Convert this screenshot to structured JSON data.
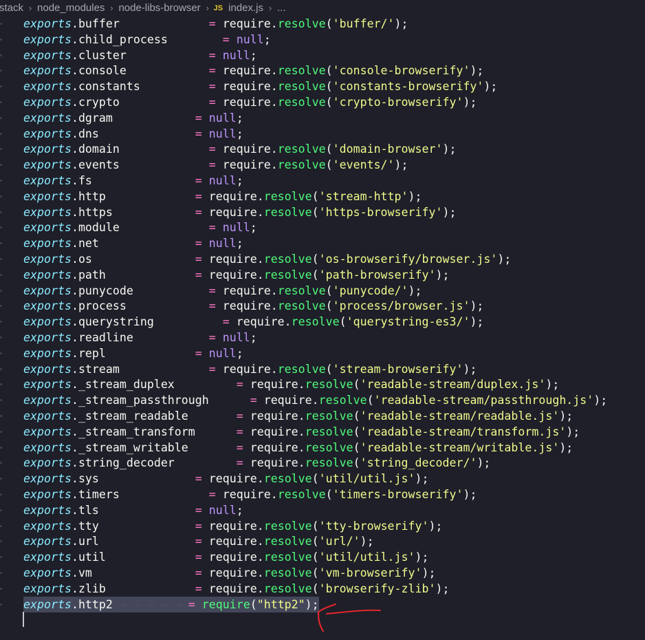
{
  "breadcrumb": {
    "items": [
      "stack",
      "node_modules",
      "node-libs-browser"
    ],
    "file_icon": "JS",
    "file_name": "index.js",
    "ellipsis": "..."
  },
  "editor": {
    "lines": [
      {
        "prop": "buffer",
        "pad": "             ",
        "value_type": "require",
        "arg": "'buffer/'",
        "end": ");"
      },
      {
        "prop": "child_process",
        "pad": "        ",
        "value_type": "null",
        "end": ";"
      },
      {
        "prop": "cluster",
        "pad": "            ",
        "value_type": "null",
        "end": ";"
      },
      {
        "prop": "console",
        "pad": "            ",
        "value_type": "require",
        "arg": "'console-browserify'",
        "end": ");"
      },
      {
        "prop": "constants",
        "pad": "          ",
        "value_type": "require",
        "arg": "'constants-browserify'",
        "end": ");"
      },
      {
        "prop": "crypto",
        "pad": "             ",
        "value_type": "require",
        "arg": "'crypto-browserify'",
        "end": ");"
      },
      {
        "prop": "dgram",
        "pad": "            ",
        "value_type": "null",
        "end": ";"
      },
      {
        "prop": "dns",
        "pad": "              ",
        "value_type": "null",
        "end": ";"
      },
      {
        "prop": "domain",
        "pad": "             ",
        "value_type": "require",
        "arg": "'domain-browser'",
        "end": ");"
      },
      {
        "prop": "events",
        "pad": "             ",
        "value_type": "require",
        "arg": "'events/'",
        "end": ");"
      },
      {
        "prop": "fs",
        "pad": "               ",
        "value_type": "null",
        "end": ";"
      },
      {
        "prop": "http",
        "pad": "             ",
        "value_type": "require",
        "arg": "'stream-http'",
        "end": ");"
      },
      {
        "prop": "https",
        "pad": "            ",
        "value_type": "require",
        "arg": "'https-browserify'",
        "end": ");"
      },
      {
        "prop": "module",
        "pad": "             ",
        "value_type": "null",
        "end": ";"
      },
      {
        "prop": "net",
        "pad": "              ",
        "value_type": "null",
        "end": ";"
      },
      {
        "prop": "os",
        "pad": "               ",
        "value_type": "require",
        "arg": "'os-browserify/browser.js'",
        "end": ");"
      },
      {
        "prop": "path",
        "pad": "             ",
        "value_type": "require",
        "arg": "'path-browserify'",
        "end": ");"
      },
      {
        "prop": "punycode",
        "pad": "           ",
        "value_type": "require",
        "arg": "'punycode/'",
        "end": ");"
      },
      {
        "prop": "process",
        "pad": "            ",
        "value_type": "require",
        "arg": "'process/browser.js'",
        "end": ");"
      },
      {
        "prop": "querystring",
        "pad": "          ",
        "value_type": "require",
        "arg": "'querystring-es3/'",
        "end": ");"
      },
      {
        "prop": "readline",
        "pad": "           ",
        "value_type": "null",
        "end": ";"
      },
      {
        "prop": "repl",
        "pad": "             ",
        "value_type": "null",
        "end": ";"
      },
      {
        "prop": "stream",
        "pad": "             ",
        "value_type": "require",
        "arg": "'stream-browserify'",
        "end": ");"
      },
      {
        "prop": "_stream_duplex",
        "pad": "         ",
        "value_type": "require",
        "arg": "'readable-stream/duplex.js'",
        "end": ");"
      },
      {
        "prop": "_stream_passthrough",
        "pad": "      ",
        "value_type": "require",
        "arg": "'readable-stream/passthrough.js'",
        "end": ");"
      },
      {
        "prop": "_stream_readable",
        "pad": "       ",
        "value_type": "require",
        "arg": "'readable-stream/readable.js'",
        "end": ");"
      },
      {
        "prop": "_stream_transform",
        "pad": "      ",
        "value_type": "require",
        "arg": "'readable-stream/transform.js'",
        "end": ");"
      },
      {
        "prop": "_stream_writable",
        "pad": "       ",
        "value_type": "require",
        "arg": "'readable-stream/writable.js'",
        "end": ");"
      },
      {
        "prop": "string_decoder",
        "pad": "         ",
        "value_type": "require",
        "arg": "'string_decoder/'",
        "end": ");"
      },
      {
        "prop": "sys",
        "pad": "              ",
        "value_type": "require",
        "arg": "'util/util.js'",
        "end": ");"
      },
      {
        "prop": "timers",
        "pad": "             ",
        "value_type": "require",
        "arg": "'timers-browserify'",
        "end": ");"
      },
      {
        "prop": "tls",
        "pad": "              ",
        "value_type": "null",
        "end": ";"
      },
      {
        "prop": "tty",
        "pad": "              ",
        "value_type": "require",
        "arg": "'tty-browserify'",
        "end": ");"
      },
      {
        "prop": "url",
        "pad": "              ",
        "value_type": "require",
        "arg": "'url/'",
        "end": ");"
      },
      {
        "prop": "util",
        "pad": "             ",
        "value_type": "require",
        "arg": "'util/util.js'",
        "end": ");"
      },
      {
        "prop": "vm",
        "pad": "               ",
        "value_type": "require",
        "arg": "'vm-browserify'",
        "end": ");"
      },
      {
        "prop": "zlib",
        "pad": "             ",
        "value_type": "require",
        "arg": "'browserify-zlib'",
        "end": ");"
      },
      {
        "prop": "http2",
        "pad": "",
        "arrows": " → → → → → ",
        "value_type": "plain-require",
        "arg": "\"http2\"",
        "end": ");",
        "selected": true
      }
    ],
    "tokens": {
      "exports": "exports",
      "dot": ".",
      "eq": "= ",
      "require": "require",
      "resolve": "resolve",
      "null": "null",
      "open": "("
    }
  },
  "colors": {
    "background": "#1e1f29",
    "exports": "#8be9fd",
    "operator": "#ff79c6",
    "function": "#50fa7b",
    "string": "#f1fa8c",
    "null": "#bd93f9",
    "annotation": "#e3262b"
  },
  "icons": [
    "chevron-right-icon",
    "js-file-icon",
    "red-arrow-annotation-icon"
  ]
}
